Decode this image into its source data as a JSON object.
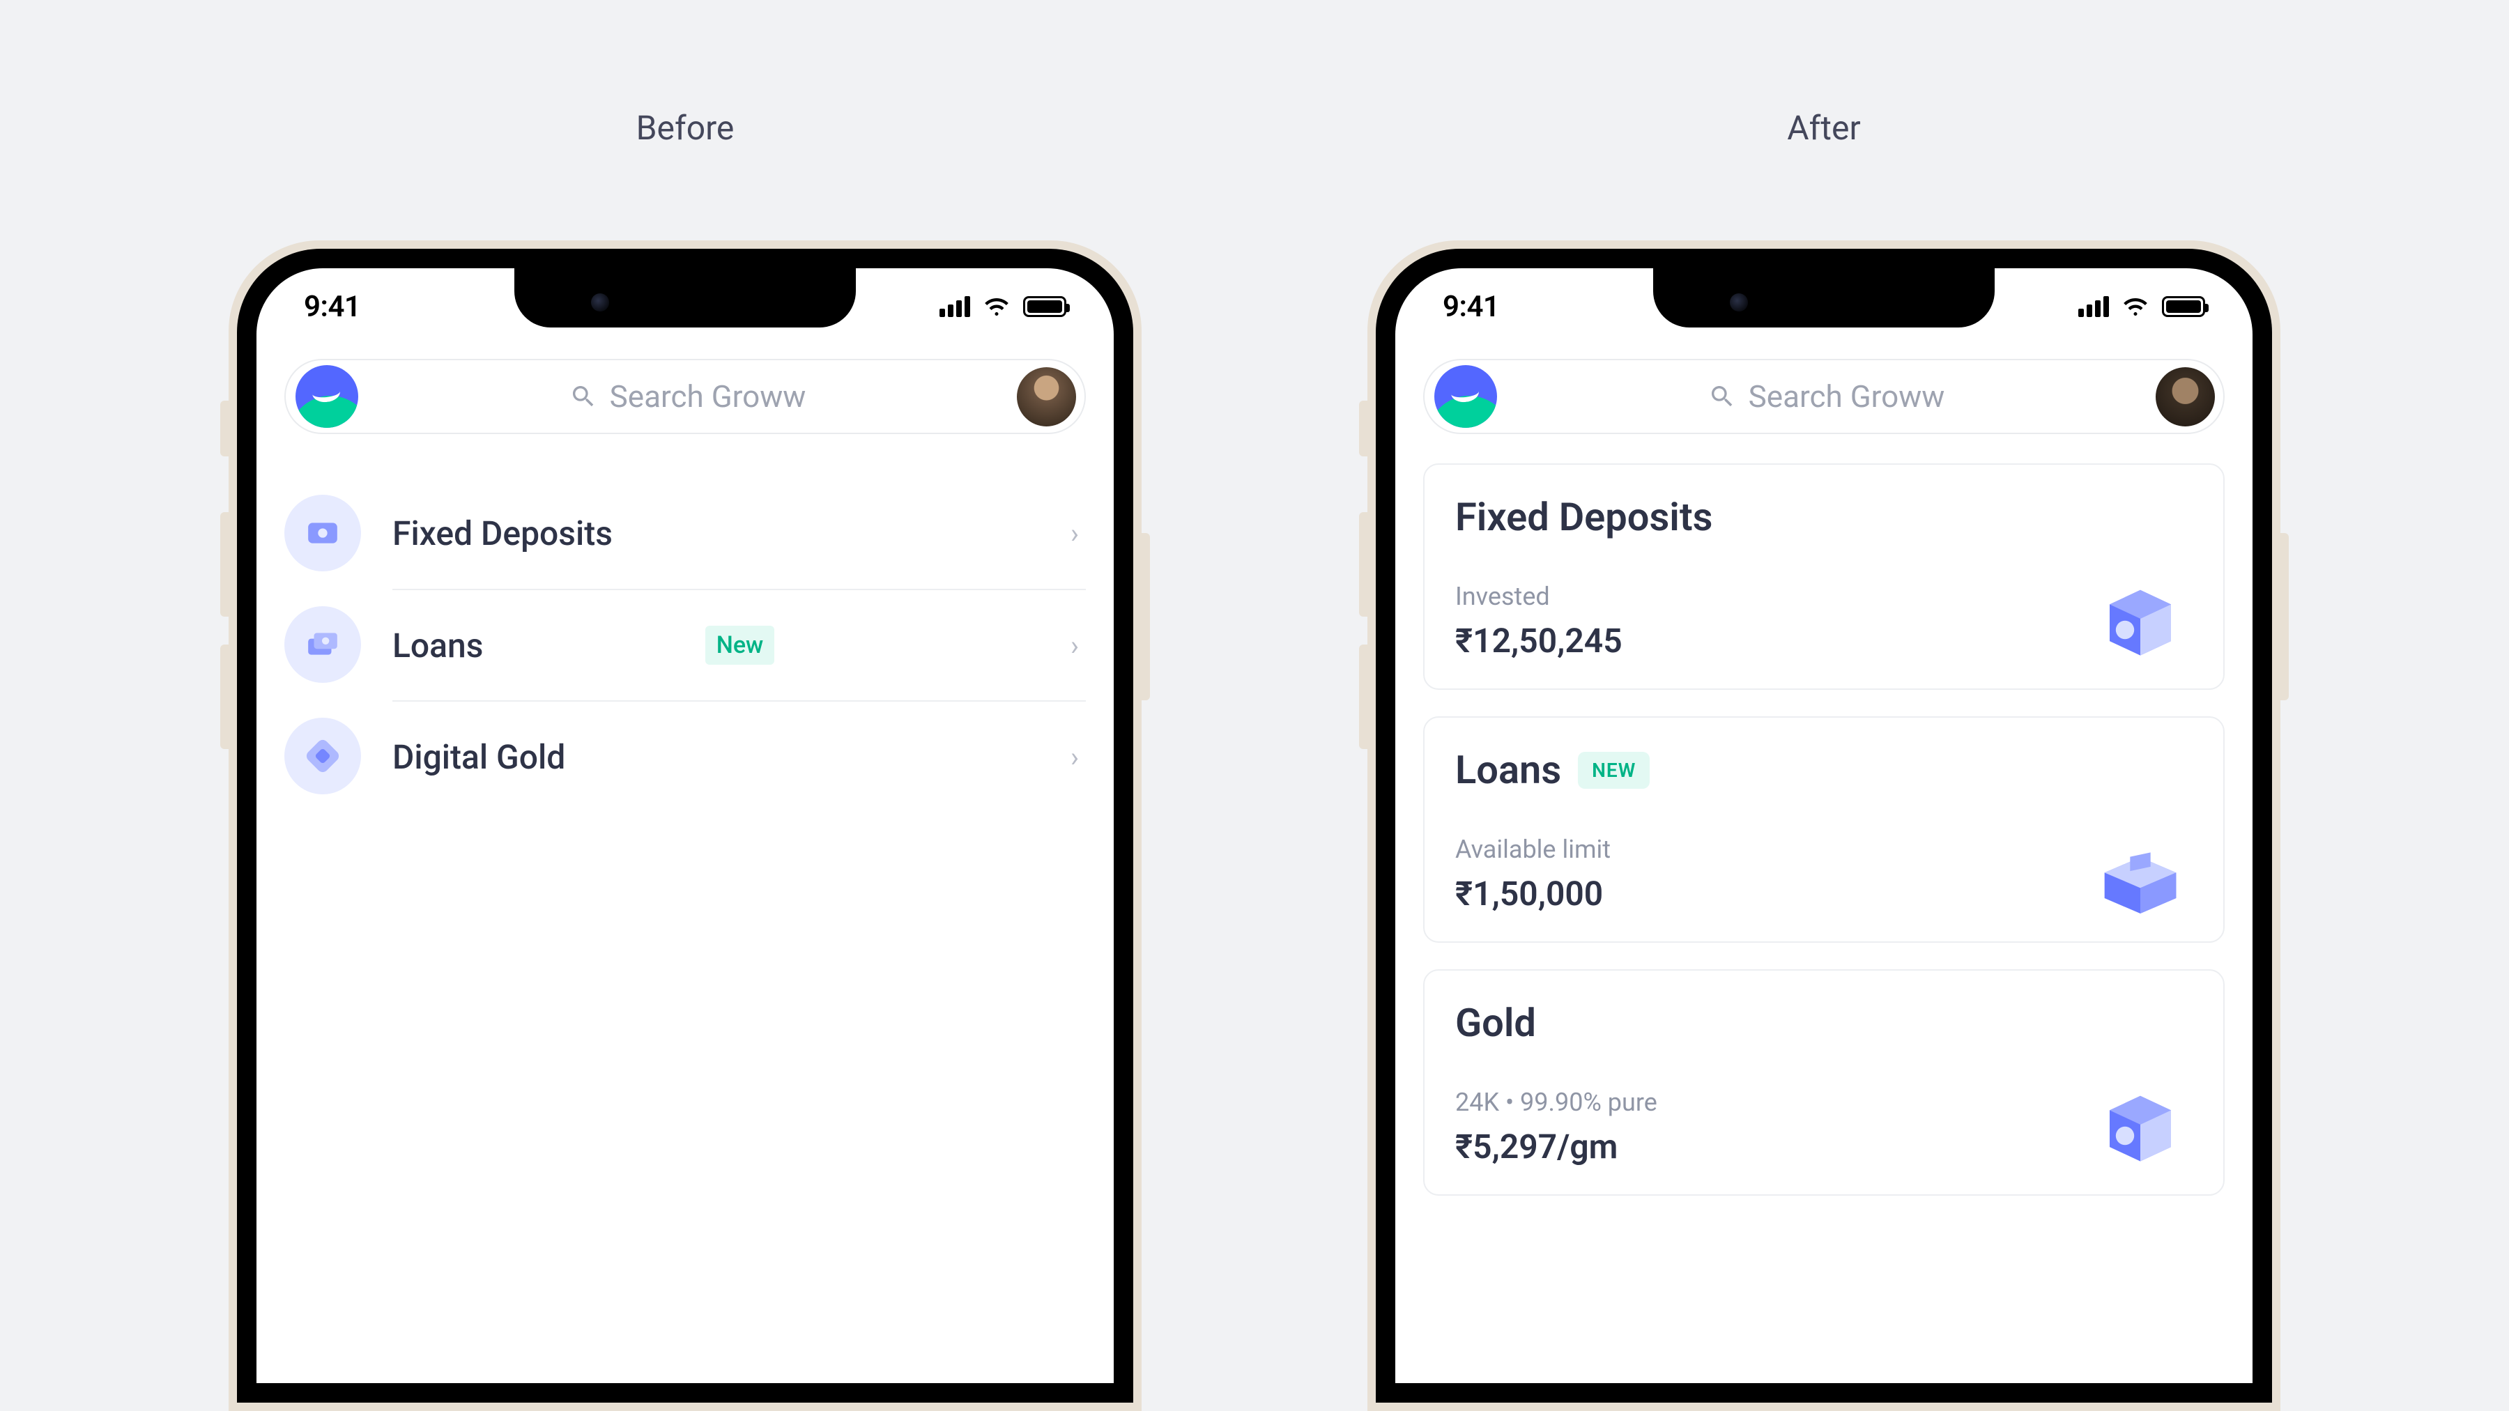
{
  "labels": {
    "before": "Before",
    "after": "After"
  },
  "status": {
    "time": "9:41"
  },
  "search": {
    "placeholder": "Search Groww"
  },
  "before_list": [
    {
      "icon": "deposit",
      "label": "Fixed Deposits",
      "badge": null
    },
    {
      "icon": "loans",
      "label": "Loans",
      "badge": "New"
    },
    {
      "icon": "gold",
      "label": "Digital Gold",
      "badge": null
    }
  ],
  "after_cards": [
    {
      "title": "Fixed Deposits",
      "badge": null,
      "sublabel": "Invested",
      "value": "₹12,50,245",
      "illus": "safe"
    },
    {
      "title": "Loans",
      "badge": "NEW",
      "sublabel": "Available limit",
      "value": "₹1,50,000",
      "illus": "box"
    },
    {
      "title": "Gold",
      "badge": null,
      "sublabel": "24K • 99.90% pure",
      "value": "₹5,297/gm",
      "illus": "safe"
    }
  ]
}
